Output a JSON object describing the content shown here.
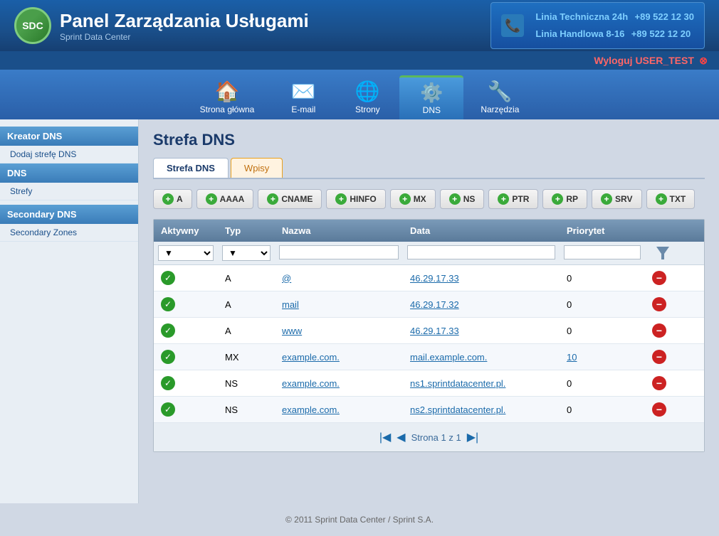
{
  "header": {
    "logo_text": "SDC",
    "title": "Panel Zarządzania Usługami",
    "subtitle": "Sprint Data Center",
    "phone_line1_label": "Linia Techniczna 24h",
    "phone_line1_number": "+89 522 12 30",
    "phone_line2_label": "Linia Handlowa 8-16",
    "phone_line2_number": "+89 522 12 20"
  },
  "topbar": {
    "logout_text": "Wyloguj USER_TEST"
  },
  "nav": {
    "items": [
      {
        "label": "Strona główna",
        "icon": "🏠",
        "active": false
      },
      {
        "label": "E-mail",
        "icon": "✉️",
        "active": false
      },
      {
        "label": "Strony",
        "icon": "🌐",
        "active": false
      },
      {
        "label": "DNS",
        "icon": "⚙️",
        "active": true
      },
      {
        "label": "Narzędzia",
        "icon": "🔧",
        "active": false
      }
    ]
  },
  "sidebar": {
    "sections": [
      {
        "header": "Kreator DNS",
        "items": [
          "Dodaj strefę DNS"
        ]
      },
      {
        "header": "DNS",
        "items": [
          "Strefy"
        ]
      },
      {
        "header": "Secondary DNS",
        "items": [
          "Secondary Zones"
        ]
      }
    ]
  },
  "main": {
    "page_title": "Strefa DNS",
    "tabs": [
      {
        "label": "Strefa DNS",
        "active": true
      },
      {
        "label": "Wpisy",
        "active": false,
        "orange": true
      }
    ],
    "dns_buttons": [
      "A",
      "AAAA",
      "CNAME",
      "HINFO",
      "MX",
      "NS",
      "PTR",
      "RP",
      "SRV",
      "TXT"
    ],
    "table": {
      "headers": [
        "Aktywny",
        "Typ",
        "Nazwa",
        "Data",
        "Priorytet",
        ""
      ],
      "rows": [
        {
          "active": true,
          "type": "A",
          "name": "@",
          "data": "46.29.17.33",
          "priority": "0"
        },
        {
          "active": true,
          "type": "A",
          "name": "mail",
          "data": "46.29.17.32",
          "priority": "0"
        },
        {
          "active": true,
          "type": "A",
          "name": "www",
          "data": "46.29.17.33",
          "priority": "0"
        },
        {
          "active": true,
          "type": "MX",
          "name": "example.com.",
          "data": "mail.example.com.",
          "priority": "10"
        },
        {
          "active": true,
          "type": "NS",
          "name": "example.com.",
          "data": "ns1.sprintdatacenter.pl.",
          "priority": "0"
        },
        {
          "active": true,
          "type": "NS",
          "name": "example.com.",
          "data": "ns2.sprintdatacenter.pl.",
          "priority": "0"
        }
      ]
    },
    "pagination_text": "Strona 1 z 1"
  },
  "footer": {
    "text": "© 2011 Sprint Data Center / Sprint S.A."
  }
}
